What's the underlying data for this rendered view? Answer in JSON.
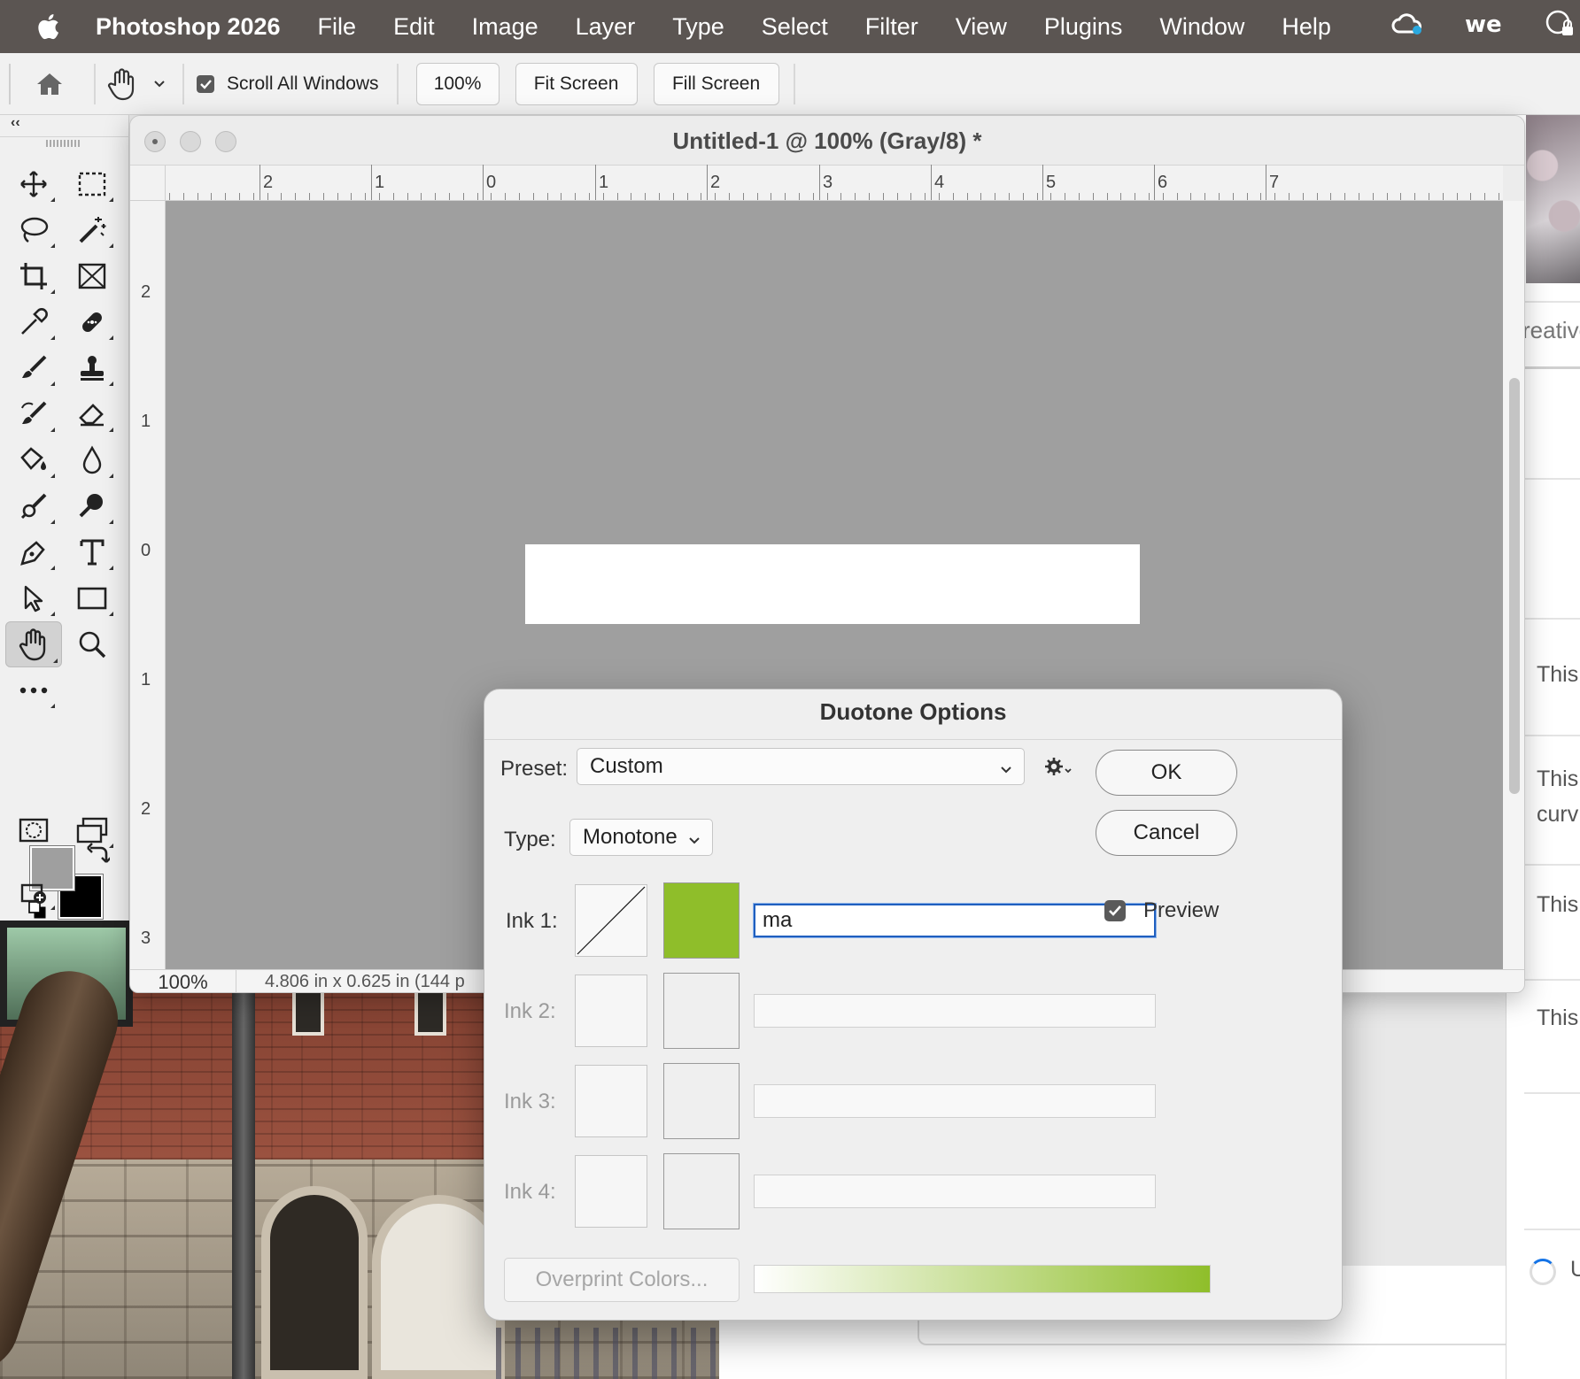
{
  "menubar": {
    "app_name": "Photoshop 2026",
    "items": [
      "File",
      "Edit",
      "Image",
      "Layer",
      "Type",
      "Select",
      "Filter",
      "View",
      "Plugins",
      "Window",
      "Help"
    ]
  },
  "options_bar": {
    "scroll_all_windows": "Scroll All Windows",
    "zoom_100": "100%",
    "fit_screen": "Fit Screen",
    "fill_screen": "Fill Screen"
  },
  "tools_panel": {
    "collapse_label": "‹‹"
  },
  "document": {
    "title": "Untitled-1 @ 100% (Gray/8) *",
    "ruler_h_labels": [
      "2",
      "1",
      "0",
      "1",
      "2",
      "3",
      "4",
      "5",
      "6",
      "7"
    ],
    "ruler_v_labels": [
      "2",
      "1",
      "0",
      "1",
      "2",
      "3"
    ],
    "status_zoom": "100%",
    "status_info": "4.806 in x 0.625 in (144 p"
  },
  "dialog": {
    "title": "Duotone Options",
    "preset_label": "Preset:",
    "preset_value": "Custom",
    "type_label": "Type:",
    "type_value": "Monotone",
    "ok": "OK",
    "cancel": "Cancel",
    "preview_label": "Preview",
    "preview_checked": true,
    "inks": [
      {
        "label": "Ink 1:",
        "name": "ma",
        "color": "#8fbe2a",
        "enabled": true
      },
      {
        "label": "Ink 2:",
        "name": "",
        "color": "",
        "enabled": false
      },
      {
        "label": "Ink 3:",
        "name": "",
        "color": "",
        "enabled": false
      },
      {
        "label": "Ink 4:",
        "name": "",
        "color": "",
        "enabled": false
      }
    ],
    "overprint": "Overprint Colors..."
  },
  "right_panel": {
    "tab_fragment": "reative",
    "items": [
      "This",
      "This",
      "curv",
      "This",
      "This"
    ],
    "loading_fragment": "U"
  },
  "colors": {
    "menubar_bg": "#5b5552",
    "ink1": "#8fbe2a",
    "canvas_bg": "#9f9f9f",
    "focus": "#1f5fbf"
  }
}
